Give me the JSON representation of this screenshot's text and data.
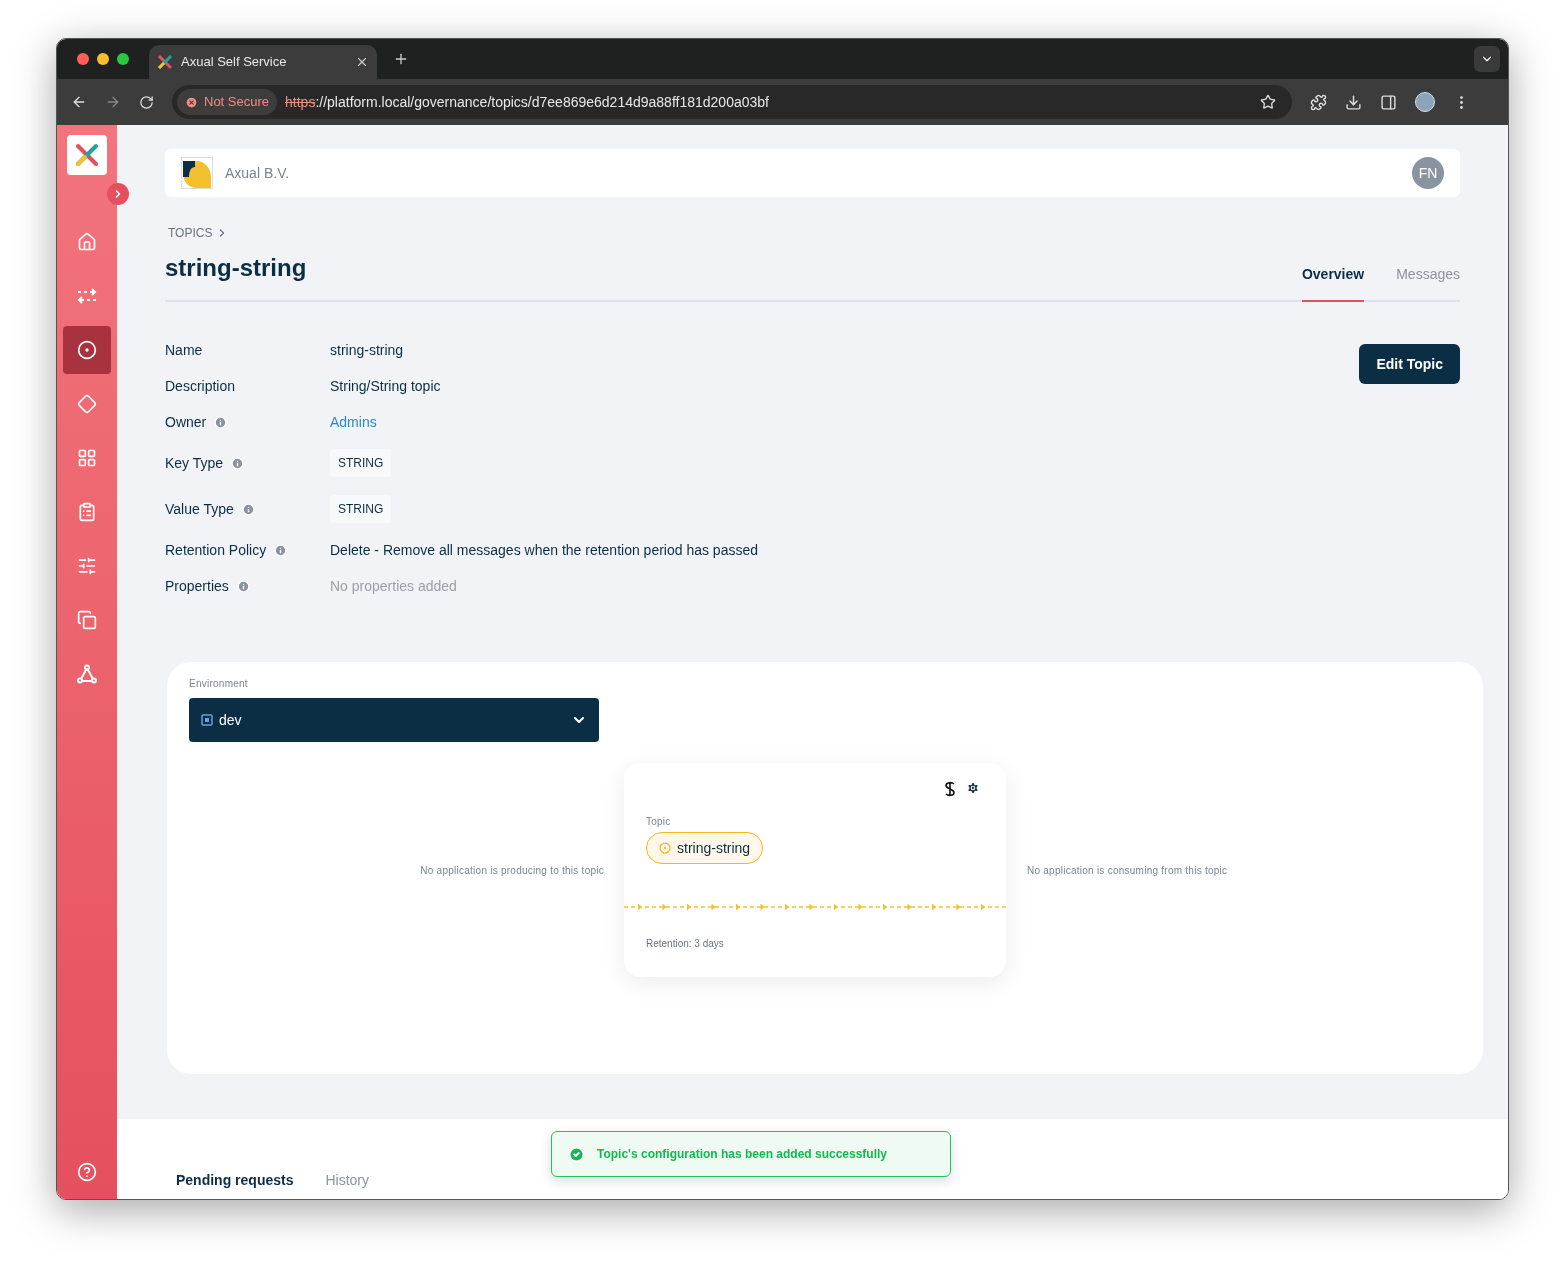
{
  "browser": {
    "tab_title": "Axual Self Service",
    "security": "Not Secure",
    "url_scheme": "https",
    "url_rest": "://platform.local/governance/topics/d7ee869e6d214d9a88ff181d200a03bf"
  },
  "sidebar": {
    "items": [
      {
        "selected": false
      },
      {
        "selected": false
      },
      {
        "selected": true
      },
      {
        "selected": false
      },
      {
        "selected": false
      },
      {
        "selected": false
      },
      {
        "selected": false
      },
      {
        "selected": false
      },
      {
        "selected": false
      }
    ]
  },
  "header": {
    "organization": "Axual B.V.",
    "avatar": "FN"
  },
  "breadcrumb": [
    "TOPICS"
  ],
  "title": "string-string",
  "tabs": [
    {
      "label": "Overview",
      "selected": true
    },
    {
      "label": "Messages",
      "selected": false
    }
  ],
  "details": [
    {
      "label": "Name",
      "info": false,
      "kind": "text",
      "value": "string-string"
    },
    {
      "label": "Description",
      "info": false,
      "kind": "text",
      "value": "String/String topic"
    },
    {
      "label": "Owner",
      "info": true,
      "kind": "link",
      "value": "Admins"
    },
    {
      "label": "Key Type",
      "info": true,
      "kind": "badge",
      "value": "STRING"
    },
    {
      "label": "Value Type",
      "info": true,
      "kind": "badge",
      "value": "STRING"
    },
    {
      "label": "Retention Policy",
      "info": true,
      "kind": "text",
      "value": "Delete - Remove all messages when the retention period has passed"
    },
    {
      "label": "Properties",
      "info": true,
      "kind": "muted",
      "value": "No properties added"
    }
  ],
  "edit_button": "Edit Topic",
  "environment": {
    "label": "Environment",
    "value": "dev"
  },
  "producers_text": "No application is producing to this topic",
  "consumers_text": "No application is consuming from this topic",
  "topic_card": {
    "label": "Topic",
    "name": "string-string",
    "retention": "Retention: 3 days"
  },
  "bottom_tabs": [
    {
      "label": "Pending requests",
      "selected": true
    },
    {
      "label": "History",
      "selected": false
    }
  ],
  "toast": {
    "message": "Topic's configuration has been added successfully"
  }
}
